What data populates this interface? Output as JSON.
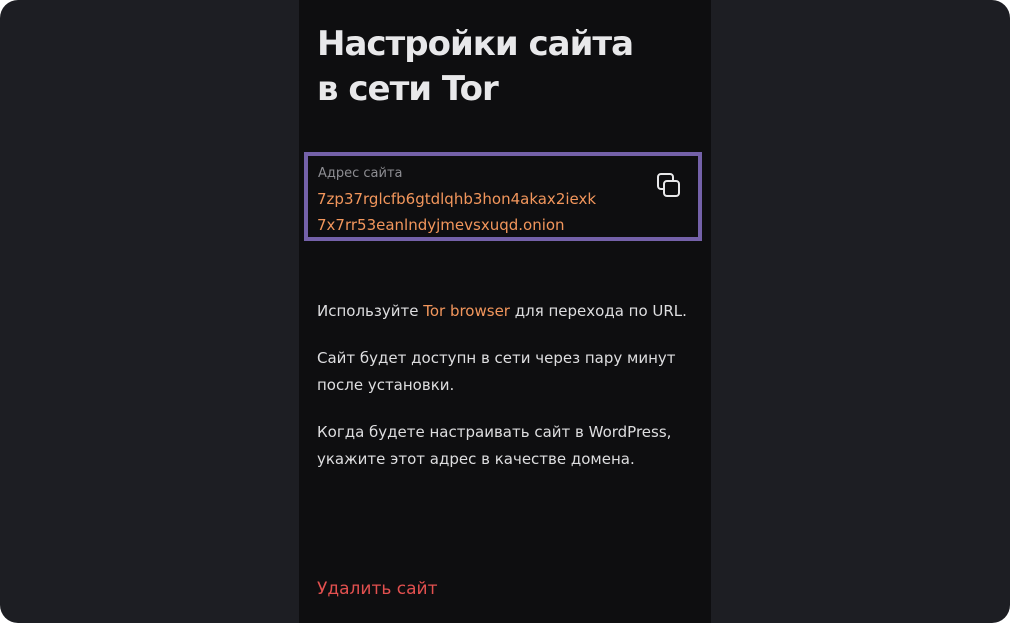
{
  "page": {
    "title_line1": "Настройки сайта",
    "title_line2": "в сети Tor"
  },
  "address": {
    "label": "Адрес сайта",
    "value_line1": "7zp37rglcfb6gtdlqhb3hon4akax2iexk",
    "value_line2": "7x7rr53eanlndyjmevsxuqd.onion",
    "copy_icon": "copy-icon"
  },
  "instructions": {
    "p1_before": "Используйте ",
    "p1_link": "Tor browser",
    "p1_after": " для перехода по URL.",
    "p2": "Сайт будет доступн в сети через пару минут после установки.",
    "p3": "Когда будете настраивать сайт в WordPress, укажите этот адрес в качестве домена."
  },
  "actions": {
    "delete_label": "Удалить сайт"
  },
  "colors": {
    "background": "#1d1e23",
    "panel": "#0e0e10",
    "accent_orange": "#f2965c",
    "highlight_border": "#7461a9",
    "danger": "#e2504f"
  }
}
